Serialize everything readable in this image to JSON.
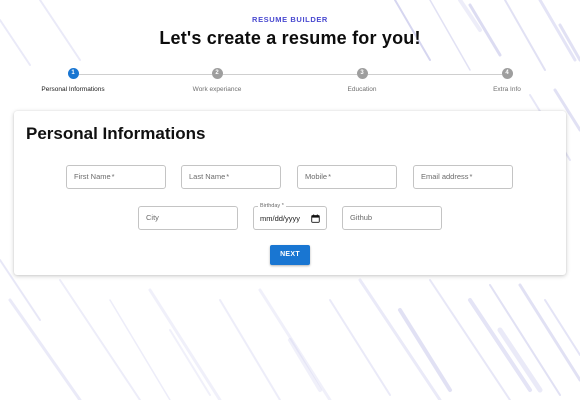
{
  "header": {
    "eyebrow": "RESUME BUILDER",
    "title": "Let's create a resume for you!"
  },
  "stepper": {
    "steps": [
      {
        "number": "1",
        "label": "Personal Informations",
        "active": true
      },
      {
        "number": "2",
        "label": "Work experiance",
        "active": false
      },
      {
        "number": "3",
        "label": "Education",
        "active": false
      },
      {
        "number": "4",
        "label": "Extra Info",
        "active": false
      }
    ]
  },
  "form": {
    "title": "Personal Informations",
    "fields": {
      "first_name": {
        "placeholder": "First Name",
        "required": "*"
      },
      "last_name": {
        "placeholder": "Last Name",
        "required": "*"
      },
      "mobile": {
        "placeholder": "Mobile",
        "required": "*"
      },
      "email": {
        "placeholder": "Email address",
        "required": "*"
      },
      "city": {
        "placeholder": "City"
      },
      "birthday": {
        "label": "Birthday *",
        "value": "mm/dd/yyyy"
      },
      "github": {
        "placeholder": "Github"
      }
    },
    "next_label": "NEXT"
  },
  "colors": {
    "accent": "#1976d2",
    "eyebrow": "#4a4ad0",
    "inactive_step": "#9e9e9e",
    "background_lines": "#b8b8e6"
  },
  "icons": {
    "birthday_picker": "calendar-icon"
  }
}
